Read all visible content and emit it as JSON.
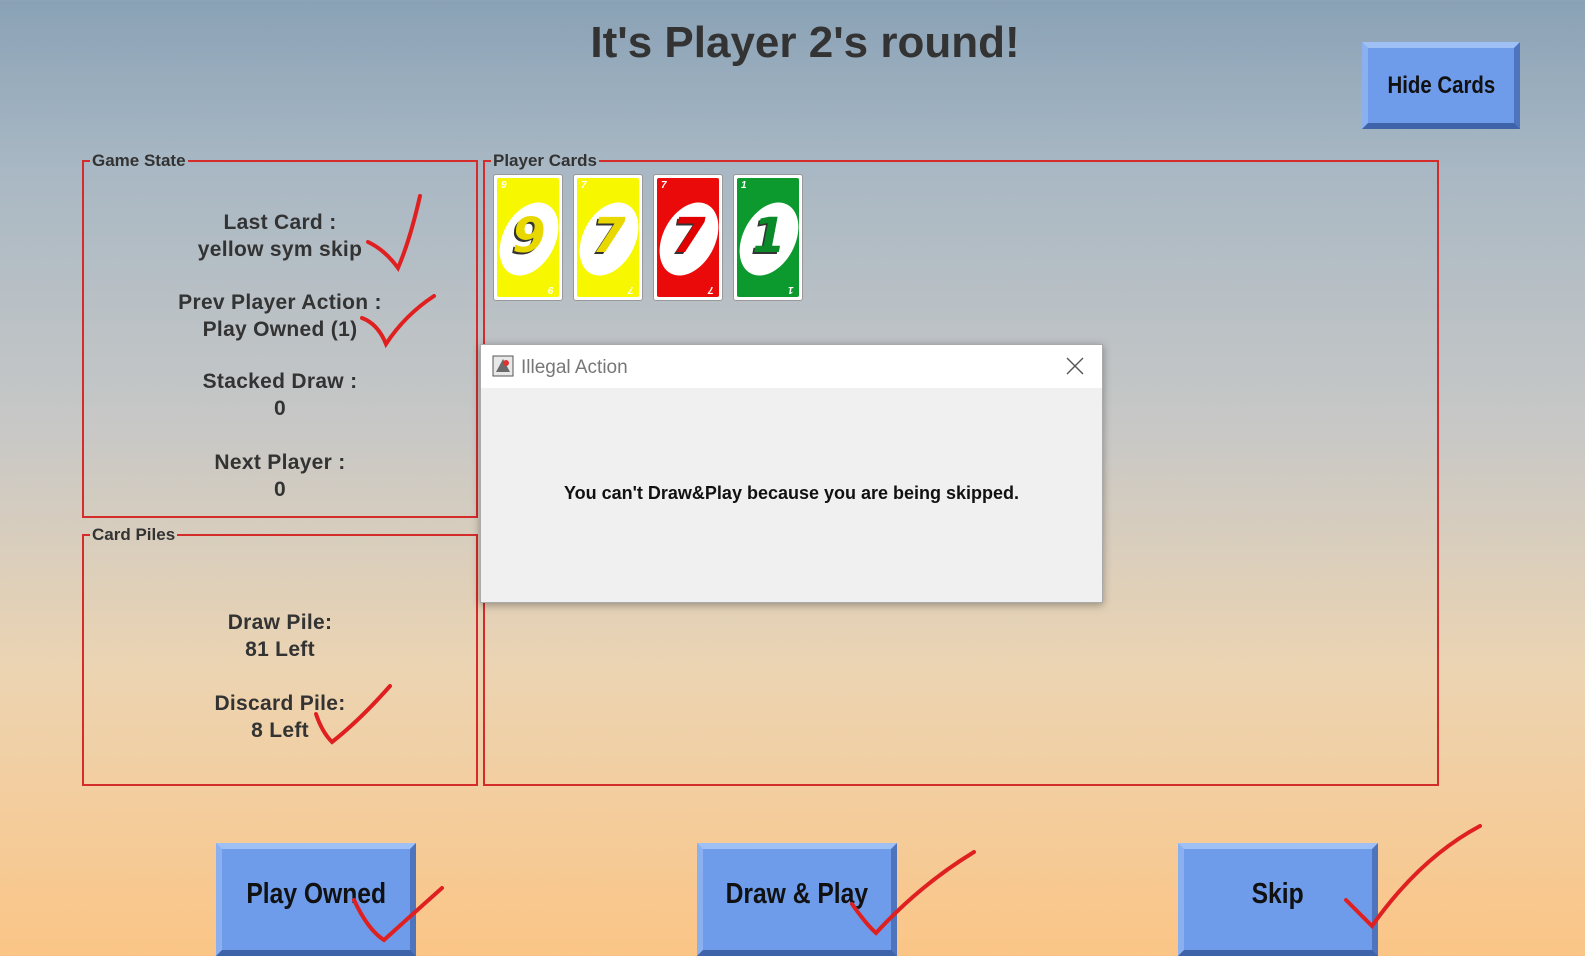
{
  "title": "It's Player 2's round!",
  "hide_button": "Hide Cards",
  "game_state": {
    "legend": "Game State",
    "last_card_label": "Last Card :",
    "last_card_value": "yellow sym skip",
    "prev_action_label": "Prev Player Action :",
    "prev_action_value": "Play Owned (1)",
    "stacked_draw_label": "Stacked Draw :",
    "stacked_draw_value": "0",
    "next_player_label": "Next Player :",
    "next_player_value": "0"
  },
  "card_piles": {
    "legend": "Card Piles",
    "draw_pile_label": "Draw Pile:",
    "draw_pile_value": "81 Left",
    "discard_pile_label": "Discard Pile:",
    "discard_pile_value": "8 Left"
  },
  "player_cards": {
    "legend": "Player Cards",
    "cards": [
      {
        "number": "9",
        "color": "yellow",
        "fill": "#f7f700",
        "ink": "#e8d800"
      },
      {
        "number": "7",
        "color": "yellow",
        "fill": "#f7f700",
        "ink": "#e8d800"
      },
      {
        "number": "7",
        "color": "red",
        "fill": "#ea0a0a",
        "ink": "#e00000"
      },
      {
        "number": "1",
        "color": "green",
        "fill": "#0c9a2e",
        "ink": "#0a8a28"
      }
    ]
  },
  "dialog": {
    "title": "Illegal Action",
    "message": "You can't Draw&Play because you are being skipped.",
    "close_icon": "close-icon"
  },
  "buttons": {
    "play_owned": "Play Owned",
    "draw_play": "Draw & Play",
    "skip": "Skip"
  },
  "annotation_color": "#e02020"
}
